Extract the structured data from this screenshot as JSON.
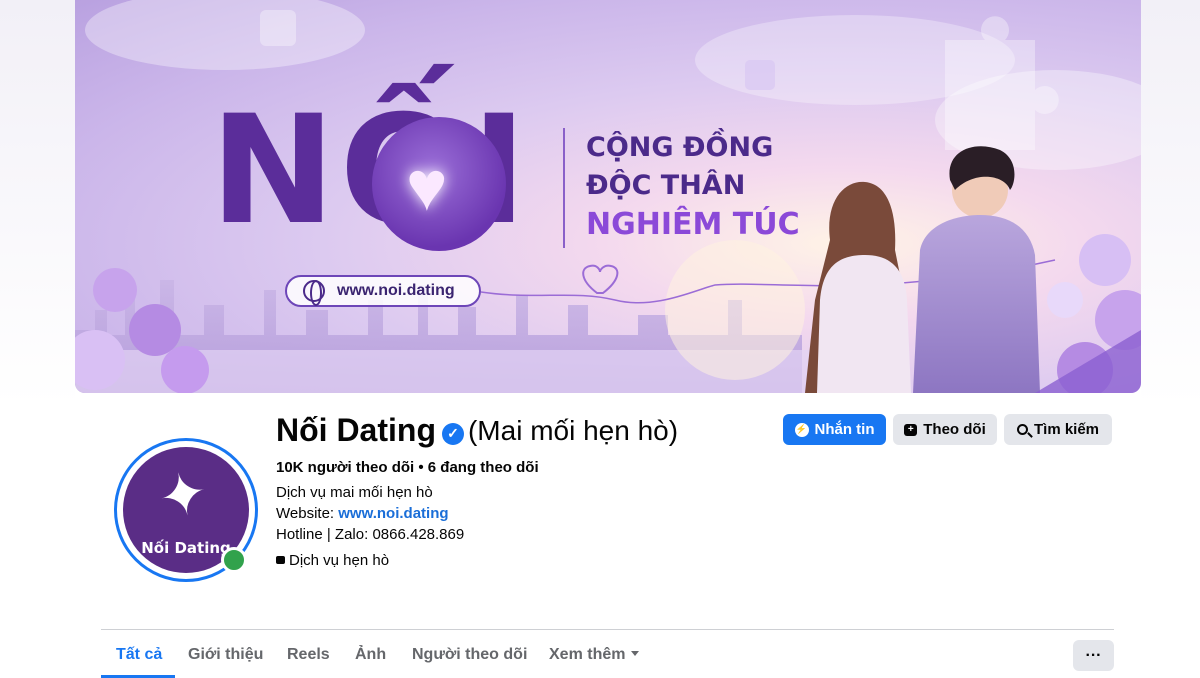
{
  "cover": {
    "brand_text": "NỐI",
    "tagline_1": "CỘNG ĐỒNG",
    "tagline_2": "ĐỘC THÂN",
    "tagline_3": "NGHIÊM TÚC",
    "url": "www.noi.dating",
    "colors": {
      "brand": "#5b2d9a",
      "accent": "#8b49d8"
    }
  },
  "profile": {
    "avatar_text": "Nối Dating",
    "name": "Nối Dating",
    "name_suffix": "(Mai mối hẹn hò)",
    "verified_icon": "verified-badge-icon",
    "stats": "10K người theo dõi • 6 đang theo dõi",
    "bio": "Dịch vụ mai mối hẹn hò",
    "website_label": "Website:",
    "website_url": "www.noi.dating",
    "hotline": "Hotline | Zalo: 0866.428.869",
    "category": "Dịch vụ hẹn hò",
    "online": true
  },
  "actions": {
    "message": "Nhắn tin",
    "follow": "Theo dõi",
    "search": "Tìm kiếm"
  },
  "tabs": [
    {
      "label": "Tất cả",
      "active": true
    },
    {
      "label": "Giới thiệu"
    },
    {
      "label": "Reels"
    },
    {
      "label": "Ảnh"
    },
    {
      "label": "Người theo dõi"
    },
    {
      "label": "Xem thêm"
    }
  ],
  "more_button": "···",
  "colors": {
    "primary": "#1877f2",
    "secondary_button": "#e4e6eb",
    "online": "#31a24c"
  }
}
